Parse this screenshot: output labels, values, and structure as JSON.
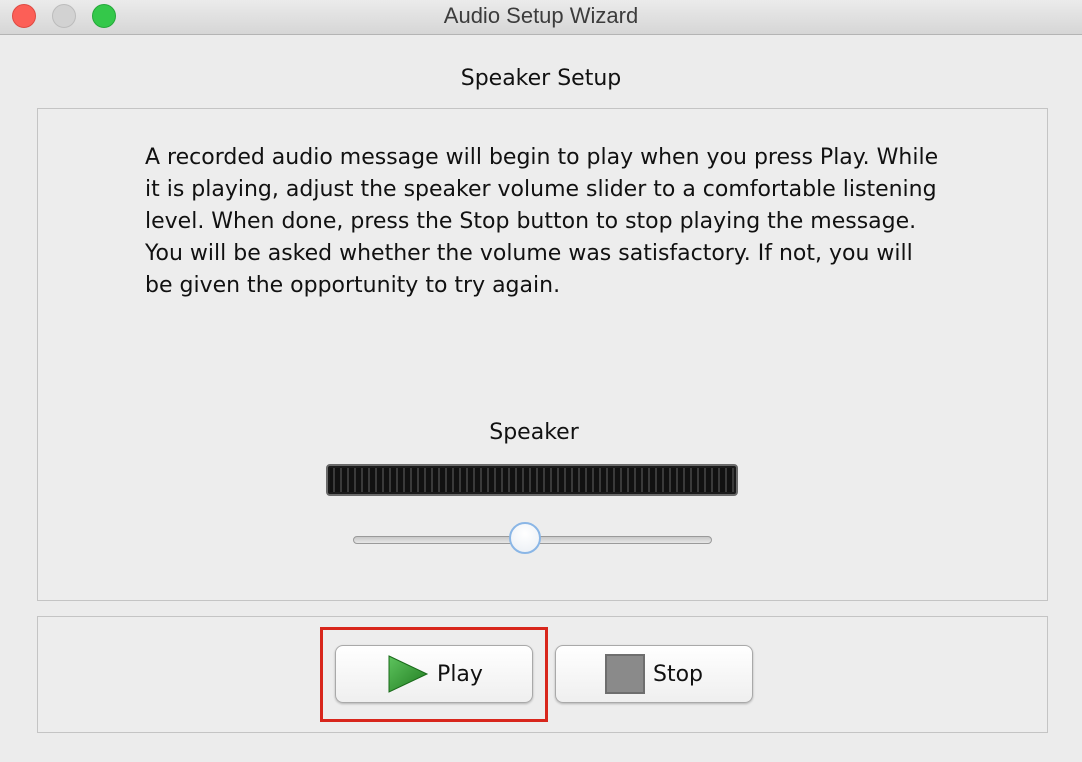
{
  "window": {
    "title": "Audio Setup Wizard",
    "controls": [
      "close",
      "minimize",
      "zoom"
    ]
  },
  "section": {
    "title": "Speaker Setup"
  },
  "instructions": "A recorded audio message will begin to play when you press Play. While it is playing, adjust the speaker volume slider to a comfortable listening level. When done, press the Stop button to stop playing the message. You will be asked whether the volume was satisfactory. If not, you will be given the opportunity to try again.",
  "speaker": {
    "label": "Speaker",
    "meter_level": 0,
    "volume": 0.48
  },
  "buttons": {
    "play_label": "Play",
    "play_icon": "play-icon",
    "stop_label": "Stop",
    "stop_icon": "stop-icon"
  },
  "colors": {
    "highlight": "#d8261c",
    "play_green": "#2e9a2e",
    "slider_thumb_border": "#8ab6e6"
  }
}
